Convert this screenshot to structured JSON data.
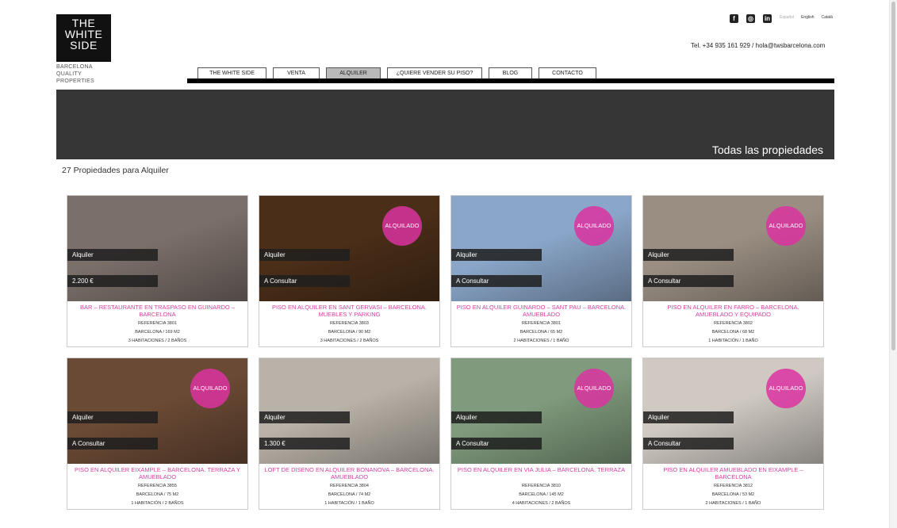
{
  "logo": {
    "line1": "THE",
    "line2": "WHITE",
    "line3": "SIDE",
    "sub1": "BARCELONA",
    "sub2": "QUALITY",
    "sub3": "PROPERTIES"
  },
  "social": [
    "facebook-icon",
    "instagram-icon",
    "linkedin-icon"
  ],
  "languages": [
    "Español",
    "English",
    "Català"
  ],
  "contact": "Tel. +34 935 161 929 / hola@twsbarcelona.com",
  "nav": [
    {
      "label": "THE WHITE SIDE",
      "active": false
    },
    {
      "label": "VENTA",
      "active": false
    },
    {
      "label": "ALQUILER",
      "active": true
    },
    {
      "label": "¿QUIERE VENDER SU PISO?",
      "active": false
    },
    {
      "label": "BLOG",
      "active": false
    },
    {
      "label": "CONTACTO",
      "active": false
    }
  ],
  "banner_title": "Todas las propiedades",
  "results_count": "27 Propiedades para Alquiler",
  "listings": [
    {
      "type": "Alquiler",
      "price": "2.200 €",
      "rented": "",
      "title": "BAR – RESTAURANTE EN TRASPASO EN GUINARDO – BARCELONA",
      "ref": "REFERENCIA 3801",
      "loc": "BARCELONA / 169 M2",
      "rooms": "3 HABITACIONES / 2 BAÑOS",
      "photo_color": "#7b6f6a"
    },
    {
      "type": "Alquiler",
      "price": "A Consultar",
      "rented": "ALQUILADO",
      "title": "PISO EN ALQUILER EN SANT GERVASI – BARCELONA. MUEBLES Y PARKING",
      "ref": "REFERENCIA 3803",
      "loc": "BARCELONA / 90 M2",
      "rooms": "3 HABITACIONES / 2 BAÑOS",
      "photo_color": "#4a2e18"
    },
    {
      "type": "Alquiler",
      "price": "A Consultar",
      "rented": "ALQUILADO",
      "title": "PISO EN ALQUILER GUINARDO – SANT PAU – BARCELONA. AMUEBLADO",
      "ref": "REFERENCIA 3801",
      "loc": "BARCELONA / 65 M2",
      "rooms": "2 HABITACIONES / 1 BAÑO",
      "photo_color": "#8aa6c9"
    },
    {
      "type": "Alquiler",
      "price": "A Consultar",
      "rented": "ALQUILADO",
      "title": "PISO EN ALQUILER EN FARRO – BARCELONA. AMUEBLADO Y EQUIPADO",
      "ref": "REFERENCIA 3802",
      "loc": "BARCELONA / 68 M2",
      "rooms": "1 HABITACIÓN / 1 BAÑO",
      "photo_color": "#9a8e82"
    },
    {
      "type": "Alquiler",
      "price": "A Consultar",
      "rented": "ALQUILADO",
      "title": "PISO EN ALQUILER EIXAMPLE – BARCELONA. TERRAZA Y AMUEBLADO",
      "ref": "REFERENCIA 3855",
      "loc": "BARCELONA / 75 M2",
      "rooms": "1 HABITACIÓN / 2 BAÑOS",
      "photo_color": "#6b4a35"
    },
    {
      "type": "Alquiler",
      "price": "1.300 €",
      "rented": "",
      "title": "LOFT DE DISENO EN ALQUILER BONANOVA – BARCELONA. AMUEBLADO",
      "ref": "REFERENCIA 3804",
      "loc": "BARCELONA / 74 M2",
      "rooms": "1 HABITACIÓN / 1 BAÑO",
      "photo_color": "#b9b2a8"
    },
    {
      "type": "Alquiler",
      "price": "A Consultar",
      "rented": "ALQUILADO",
      "title": "PISO EN ALQUILER EN VIA JULIA – BARCELONA. TERRAZA",
      "ref": "REFERENCIA 3810",
      "loc": "BARCELONA / 145 M2",
      "rooms": "4 HABITACIONES / 2 BAÑOS",
      "photo_color": "#7f9a7c"
    },
    {
      "type": "Alquiler",
      "price": "A Consultar",
      "rented": "ALQUILADO",
      "title": "PISO EN ALQUILER AMUEBLADO EN EIXAMPLE – BARCELONA",
      "ref": "REFERENCIA 3812",
      "loc": "BARCELONA / 53 M2",
      "rooms": "2 HABITACIONES / 1 BAÑO",
      "photo_color": "#cfc9c2"
    }
  ]
}
